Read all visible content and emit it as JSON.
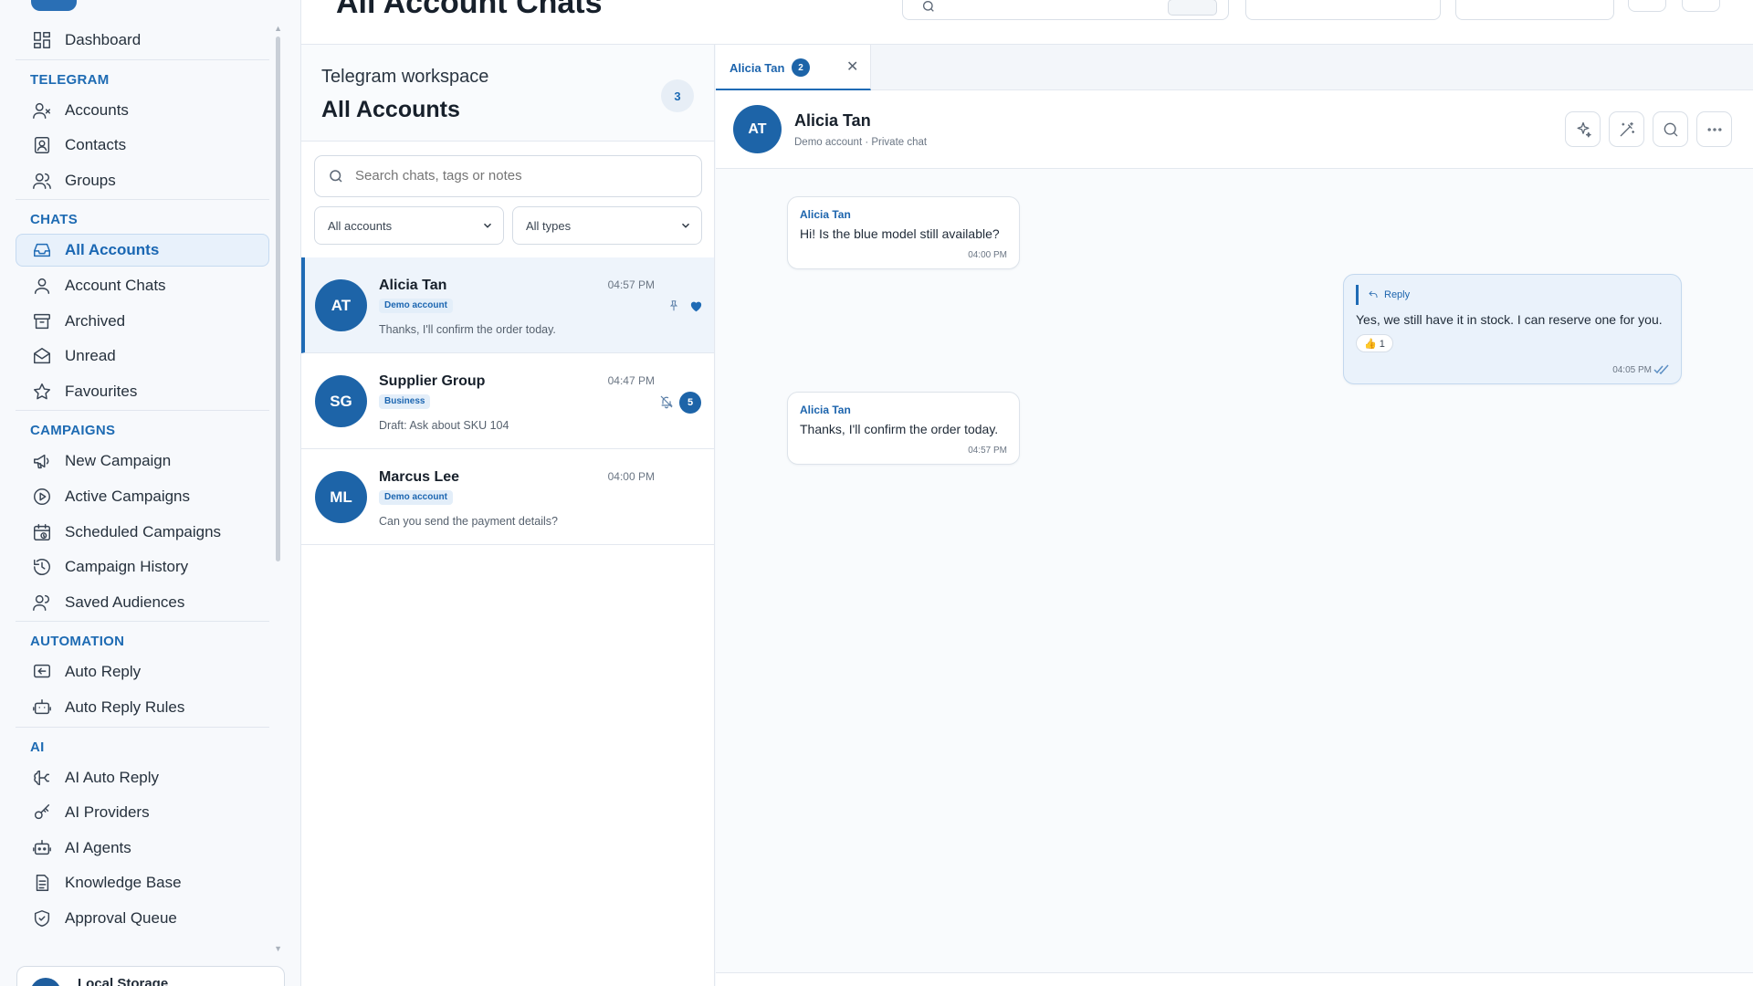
{
  "topbar": {
    "title": "All Account Chats"
  },
  "sidebar": {
    "footer_name": "Local Storage",
    "groups": [
      {
        "section": "",
        "items": [
          {
            "label": "Dashboard",
            "icon": "dashboard-icon"
          }
        ]
      },
      {
        "section": "TELEGRAM",
        "items": [
          {
            "label": "Accounts",
            "icon": "accounts-icon"
          },
          {
            "label": "Contacts",
            "icon": "contacts-icon"
          },
          {
            "label": "Groups",
            "icon": "groups-icon"
          }
        ]
      },
      {
        "section": "CHATS",
        "items": [
          {
            "label": "All Accounts",
            "icon": "inbox-icon",
            "active": true
          },
          {
            "label": "Account Chats",
            "icon": "user-icon"
          },
          {
            "label": "Archived",
            "icon": "archive-icon"
          },
          {
            "label": "Unread",
            "icon": "envelope-icon"
          },
          {
            "label": "Favourites",
            "icon": "star-icon"
          }
        ]
      },
      {
        "section": "CAMPAIGNS",
        "items": [
          {
            "label": "New Campaign",
            "icon": "megaphone-icon"
          },
          {
            "label": "Active Campaigns",
            "icon": "play-circle-icon"
          },
          {
            "label": "Scheduled Campaigns",
            "icon": "calendar-clock-icon"
          },
          {
            "label": "Campaign History",
            "icon": "history-icon"
          },
          {
            "label": "Saved Audiences",
            "icon": "audience-icon"
          }
        ]
      },
      {
        "section": "AUTOMATION",
        "items": [
          {
            "label": "Auto Reply",
            "icon": "reply-message-icon"
          },
          {
            "label": "Auto Reply Rules",
            "icon": "bot-rules-icon"
          }
        ]
      },
      {
        "section": "AI",
        "items": [
          {
            "label": "AI Auto Reply",
            "icon": "brain-icon"
          },
          {
            "label": "AI Providers",
            "icon": "key-icon"
          },
          {
            "label": "AI Agents",
            "icon": "robot-icon"
          },
          {
            "label": "Knowledge Base",
            "icon": "document-icon"
          },
          {
            "label": "Approval Queue",
            "icon": "shield-check-icon"
          }
        ]
      }
    ]
  },
  "list": {
    "subtitle": "Telegram workspace",
    "title": "All Accounts",
    "count": "3",
    "search_placeholder": "Search chats, tags or notes",
    "filter_accounts": "All accounts",
    "filter_types": "All types",
    "chats": [
      {
        "initials": "AT",
        "name": "Alicia Tan",
        "time": "04:57 PM",
        "badge": "Demo account",
        "preview": "Thanks, I'll confirm the order today.",
        "pinned": true,
        "favourite": true,
        "active": true
      },
      {
        "initials": "SG",
        "name": "Supplier Group",
        "time": "04:47 PM",
        "badge": "Business",
        "preview": "Draft: Ask about SKU 104",
        "muted": true,
        "unread": "5"
      },
      {
        "initials": "ML",
        "name": "Marcus Lee",
        "time": "04:00 PM",
        "badge": "Demo account",
        "preview": "Can you send the payment details?"
      }
    ]
  },
  "conversation": {
    "tab_label": "Alicia Tan",
    "tab_badge": "2",
    "initials": "AT",
    "name": "Alicia Tan",
    "subtitle": "Demo account · Private chat",
    "header_actions": [
      "sparkle-icon",
      "magic-wand-icon",
      "search-icon",
      "more-icon"
    ],
    "messages": [
      {
        "direction": "in",
        "sender": "Alicia Tan",
        "text": "Hi! Is the blue model still available?",
        "time": "04:00 PM"
      },
      {
        "direction": "out",
        "reply_label": "Reply",
        "text": "Yes, we still have it in stock. I can reserve one for you.",
        "reaction": "👍 1",
        "time": "04:05 PM",
        "read": true
      },
      {
        "direction": "in",
        "sender": "Alicia Tan",
        "text": "Thanks, I'll confirm the order today.",
        "time": "04:57 PM"
      }
    ]
  },
  "colors": {
    "accent": "#1f6bb5",
    "avatar": "#1d64a8",
    "active_bg": "#e8f1fb"
  }
}
